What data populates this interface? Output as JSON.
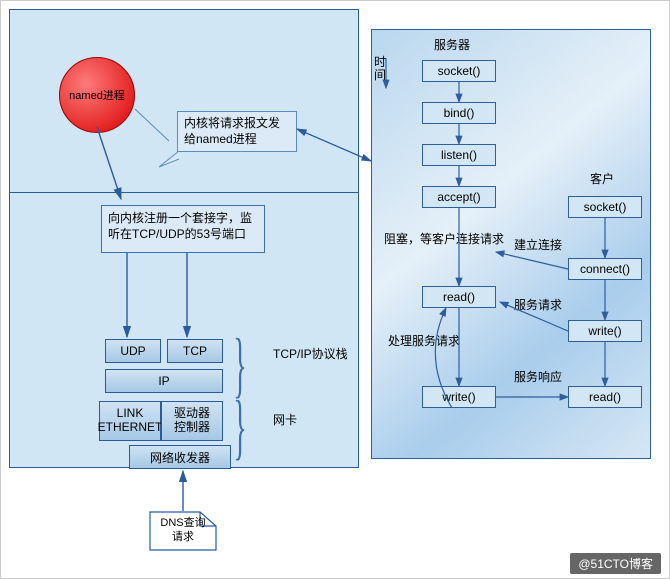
{
  "left": {
    "named_process": "named进程",
    "callout": "内核将请求报文发给named进程",
    "register": "向内核注册一个套接字，监听在TCP/UDP的53号端口",
    "stack": {
      "udp": "UDP",
      "tcp": "TCP",
      "ip": "IP",
      "link1": "LINK",
      "link2": "ETHERNET",
      "ctrl1": "驱动器",
      "ctrl2": "控制器",
      "net_transceiver": "网络收发器"
    },
    "labels": {
      "tcpip_stack": "TCP/IP协议栈",
      "nic": "网卡"
    },
    "dns_query": {
      "line1": "DNS查询",
      "line2": "请求"
    }
  },
  "right": {
    "server_title": "服务器",
    "client_title": "客户",
    "time_label": {
      "line1": "时",
      "line2": "间"
    },
    "server": {
      "socket": "socket()",
      "bind": "bind()",
      "listen": "listen()",
      "accept": "accept()",
      "read": "read()",
      "write": "write()"
    },
    "client": {
      "socket": "socket()",
      "connect": "connect()",
      "write": "write()",
      "read": "read()"
    },
    "flow": {
      "blocked": "阻塞，等客户连接请求",
      "establish": "建立连接",
      "service_request": "服务请求",
      "handle": "处理服务请求",
      "service_response": "服务响应"
    }
  },
  "watermark": "@51CTO博客"
}
